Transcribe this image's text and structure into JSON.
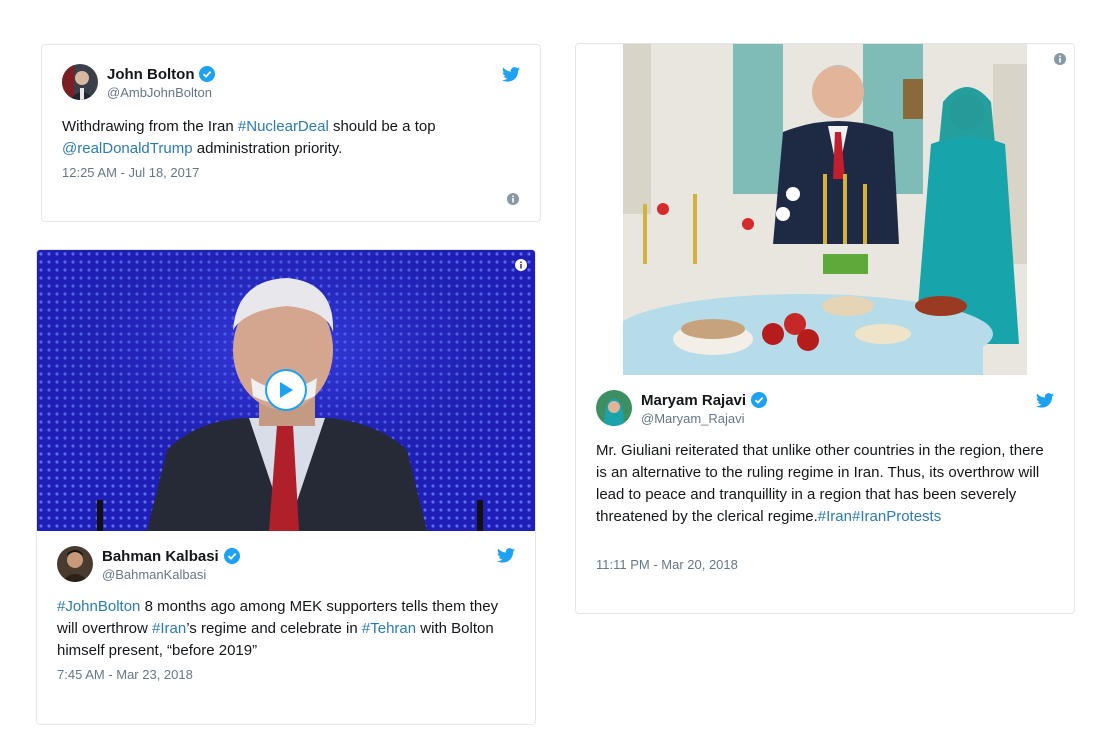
{
  "tweets": [
    {
      "name": "John Bolton",
      "handle": "@AmbJohnBolton",
      "text": {
        "t1": "Withdrawing from the Iran ",
        "l1": "#NuclearDeal",
        "t2": " should be a top ",
        "l2": "@realDonaldTrump",
        "t3": " administration priority."
      },
      "timestamp": "12:25 AM - Jul 18, 2017"
    },
    {
      "name": "Bahman Kalbasi",
      "handle": "@BahmanKalbasi",
      "text": {
        "l1": "#JohnBolton",
        "t1": " 8 months ago among MEK supporters tells them they will overthrow ",
        "l2": "#Iran",
        "t2": "’s regime and celebrate in ",
        "l3": "#Tehran",
        "t3": " with Bolton himself present, “before 2019”"
      },
      "timestamp": "7:45 AM - Mar 23, 2018"
    },
    {
      "name": "Maryam Rajavi",
      "handle": "@Maryam_Rajavi",
      "text": {
        "t1": "Mr. Giuliani reiterated that unlike other countries in the region, there is an alternative to the ruling regime in Iran. Thus, its overthrow will lead to peace and tranquillity in a region that has been severely threatened by the clerical regime.",
        "l1": "#Iran",
        "l2": "#IranProtests"
      },
      "timestamp": "11:11 PM - Mar 20, 2018"
    }
  ],
  "colors": {
    "link": "#2b7bb9",
    "twitter_blue": "#1da1f2",
    "secondary_text": "#657786",
    "border": "#e1e8ed"
  },
  "icons": [
    "twitter-bird-icon",
    "verified-badge-icon",
    "info-icon",
    "play-icon"
  ]
}
